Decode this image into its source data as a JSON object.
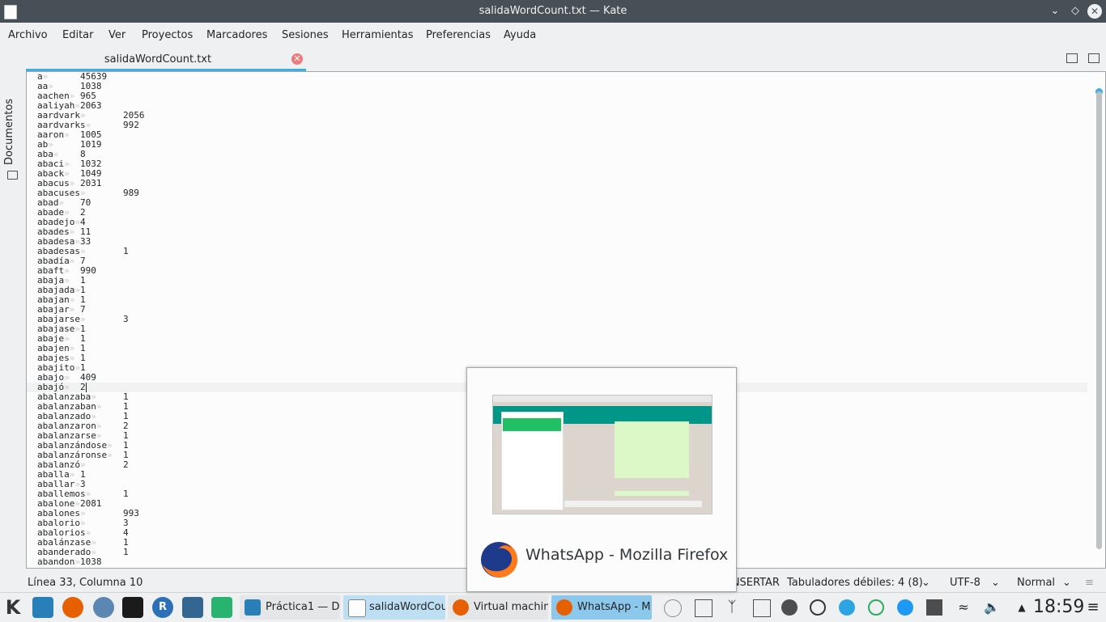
{
  "window": {
    "title": "salidaWordCount.txt  — Kate"
  },
  "menu": [
    "Archivo",
    "Editar",
    "Ver",
    "Proyectos",
    "Marcadores",
    "Sesiones",
    "Herramientas",
    "Preferencias",
    "Ayuda"
  ],
  "sidebar": {
    "documents_label": "Documentos"
  },
  "tab": {
    "label": "salidaWordCount.txt"
  },
  "editor": {
    "lines": [
      [
        "a",
        "45639"
      ],
      [
        "aa",
        "1038"
      ],
      [
        "aachen",
        "965"
      ],
      [
        "aaliyah",
        "2063"
      ],
      [
        "aardvark",
        "2056"
      ],
      [
        "aardvarks",
        "992"
      ],
      [
        "aaron",
        "1005"
      ],
      [
        "ab",
        "1019"
      ],
      [
        "aba",
        "8"
      ],
      [
        "abaci",
        "1032"
      ],
      [
        "aback",
        "1049"
      ],
      [
        "abacus",
        "2031"
      ],
      [
        "abacuses",
        "989"
      ],
      [
        "abad",
        "70"
      ],
      [
        "abade",
        "2"
      ],
      [
        "abadejo",
        "4"
      ],
      [
        "abades",
        "11"
      ],
      [
        "abadesa",
        "33"
      ],
      [
        "abadesas",
        "1"
      ],
      [
        "abadía",
        "7"
      ],
      [
        "abaft",
        "990"
      ],
      [
        "abaja",
        "1"
      ],
      [
        "abajada",
        "1"
      ],
      [
        "abajan",
        "1"
      ],
      [
        "abajar",
        "7"
      ],
      [
        "abajarse",
        "3"
      ],
      [
        "abajase",
        "1"
      ],
      [
        "abaje",
        "1"
      ],
      [
        "abajen",
        "1"
      ],
      [
        "abajes",
        "1"
      ],
      [
        "abajito",
        "1"
      ],
      [
        "abajo",
        "409"
      ],
      [
        "abajó",
        "2"
      ],
      [
        "abalanzaba",
        "1"
      ],
      [
        "abalanzaban",
        "1"
      ],
      [
        "abalanzado",
        "1"
      ],
      [
        "abalanzaron",
        "2"
      ],
      [
        "abalanzarse",
        "1"
      ],
      [
        "abalanzándose",
        "1"
      ],
      [
        "abalanzáronse",
        "1"
      ],
      [
        "abalanzó",
        "2"
      ],
      [
        "aballa",
        "1"
      ],
      [
        "aballar",
        "3"
      ],
      [
        "aballemos",
        "1"
      ],
      [
        "abalone",
        "2081"
      ],
      [
        "abalones",
        "993"
      ],
      [
        "abalorio",
        "3"
      ],
      [
        "abalorios",
        "4"
      ],
      [
        "abalánzase",
        "1"
      ],
      [
        "abanderado",
        "1"
      ],
      [
        "abandon",
        "1038"
      ]
    ],
    "current_line_index": 32
  },
  "status": {
    "position": "Línea 33, Columna 10",
    "mode": "INSERTAR",
    "tabs": "Tabuladores débiles: 4 (8)",
    "encoding": "UTF-8",
    "highlight": "Normal"
  },
  "taskbar": {
    "tasks": [
      "Práctica1 — D",
      "salidaWordCou",
      "Virtual machin",
      "WhatsApp - M"
    ],
    "clock": "18:59"
  },
  "preview": {
    "title": "WhatsApp - Mozilla Firefox"
  },
  "colors": {
    "accent": "#3daee9",
    "titlebar": "#475057",
    "background": "#eff0f1"
  }
}
